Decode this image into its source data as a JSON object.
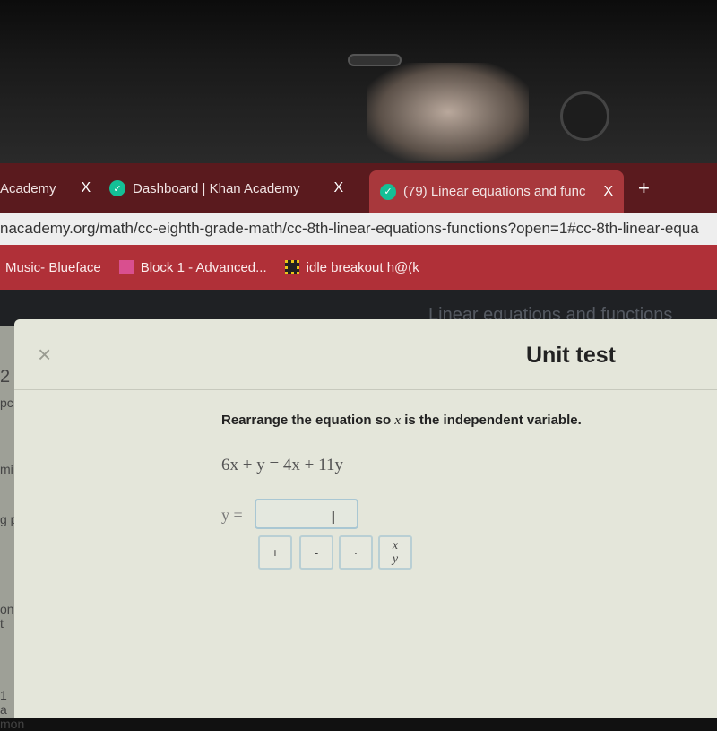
{
  "browser": {
    "tabs": [
      {
        "label": "Academy",
        "close": "X"
      },
      {
        "label": "Dashboard | Khan Academy",
        "close": "X"
      },
      {
        "label": "(79) Linear equations and func",
        "close": "X",
        "active": true
      }
    ],
    "new_tab": "+",
    "url": "nacademy.org/math/cc-eighth-grade-math/cc-8th-linear-equations-functions?open=1#cc-8th-linear-equa",
    "bookmarks": [
      {
        "label": "Music- Blueface"
      },
      {
        "label": "Block 1 - Advanced..."
      },
      {
        "label": "idle breakout h@(k"
      }
    ],
    "colors": {
      "tabbar": "#5a1a1e",
      "active_tab": "#a8383c",
      "bookmarks": "#b03038",
      "khan": "#14bf96"
    }
  },
  "background_page": {
    "title": "Linear equations and functions",
    "left_fragments": [
      "2",
      "pc",
      "mi",
      "g p",
      "ons t",
      "1",
      "a mon"
    ]
  },
  "modal": {
    "close": "×",
    "title": "Unit test",
    "prompt_before": "Rearrange the equation so ",
    "prompt_var": "x",
    "prompt_after": " is the independent variable.",
    "equation": "6x + y = 4x + 11y",
    "answer_label": "y =",
    "answer_value": "",
    "keypad": [
      "+",
      "-",
      "·"
    ],
    "fraction_key": {
      "num": "x",
      "den": "y"
    }
  }
}
